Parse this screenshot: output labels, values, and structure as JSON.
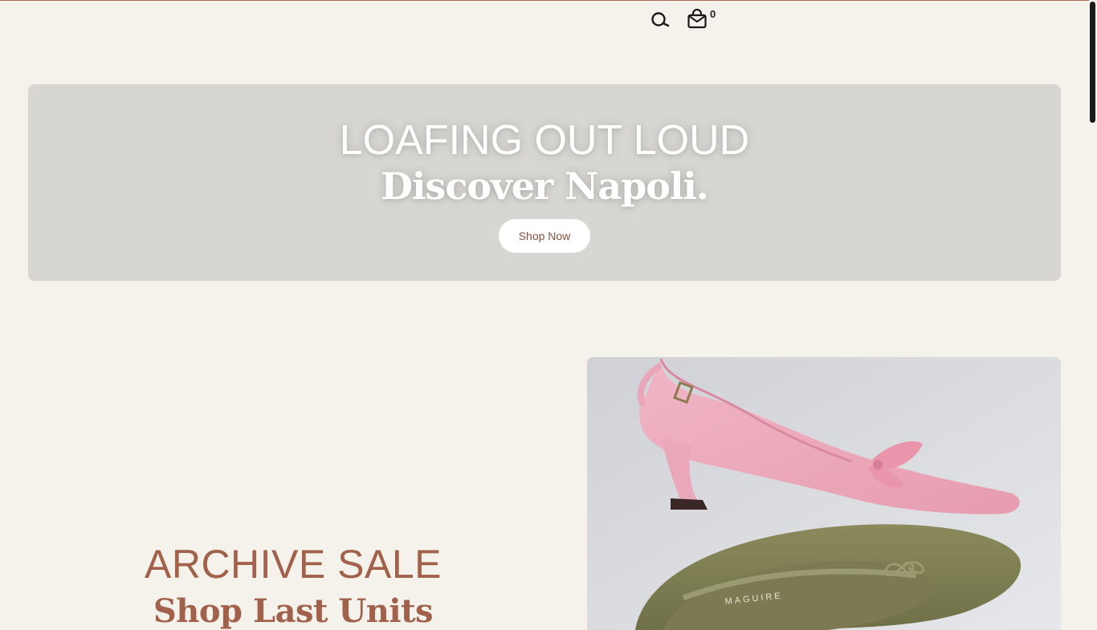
{
  "header": {
    "search_icon": "search-icon",
    "cart_icon": "shopping-bag-icon",
    "cart_count": "0"
  },
  "hero": {
    "title": "LOAFING OUT LOUD",
    "subtitle": "Discover Napoli.",
    "cta_label": "Shop Now",
    "background": "#d7d6d2"
  },
  "sale": {
    "title": "ARCHIVE SALE",
    "subtitle": "Shop Last Units"
  },
  "product_image": {
    "brand_mark": "MAGUIRE"
  },
  "colors": {
    "page_background": "#f5f2ec",
    "accent": "#a2614a",
    "button_text": "#8a4f3a"
  }
}
